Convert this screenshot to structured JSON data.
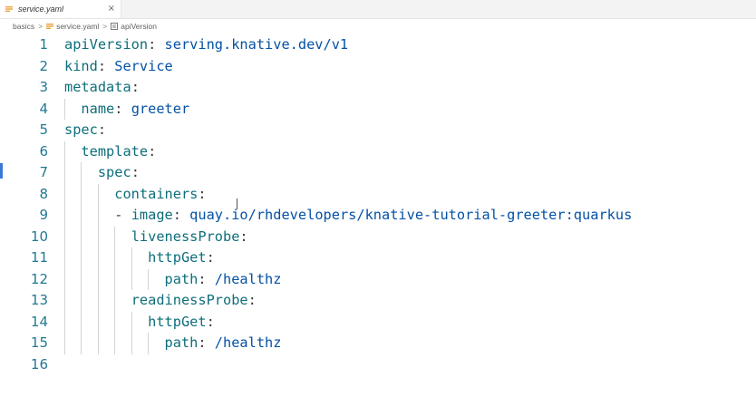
{
  "tab": {
    "label": "service.yaml",
    "close_glyph": "×",
    "icon": "yaml-file-icon"
  },
  "breadcrumb": {
    "items": [
      "basics",
      "service.yaml",
      "apiVersion"
    ],
    "separator": ">"
  },
  "editor": {
    "lines": [
      {
        "n": "1",
        "key": "apiVersion",
        "sep": ": ",
        "value": "serving.knative.dev/v1"
      },
      {
        "n": "2",
        "key": "kind",
        "sep": ": ",
        "value": "Service"
      },
      {
        "n": "3",
        "key": "metadata",
        "sep": ":",
        "value": ""
      },
      {
        "n": "4",
        "key": "name",
        "sep": ": ",
        "value": "greeter"
      },
      {
        "n": "5",
        "key": "spec",
        "sep": ":",
        "value": ""
      },
      {
        "n": "6",
        "key": "template",
        "sep": ":",
        "value": ""
      },
      {
        "n": "7",
        "key": "spec",
        "sep": ":",
        "value": ""
      },
      {
        "n": "8",
        "key": "containers",
        "sep": ":",
        "value": ""
      },
      {
        "n": "9",
        "dash": "- ",
        "key": "image",
        "sep": ": ",
        "value": "quay.io/rhdevelopers/knative-tutorial-greeter:quarkus"
      },
      {
        "n": "10",
        "key": "livenessProbe",
        "sep": ":",
        "value": ""
      },
      {
        "n": "11",
        "key": "httpGet",
        "sep": ":",
        "value": ""
      },
      {
        "n": "12",
        "key": "path",
        "sep": ": ",
        "value": "/healthz"
      },
      {
        "n": "13",
        "key": "readinessProbe",
        "sep": ":",
        "value": ""
      },
      {
        "n": "14",
        "key": "httpGet",
        "sep": ":",
        "value": ""
      },
      {
        "n": "15",
        "key": "path",
        "sep": ": ",
        "value": "/healthz"
      },
      {
        "n": "16",
        "key": "",
        "sep": "",
        "value": ""
      }
    ]
  },
  "colors": {
    "key": "#800000",
    "value": "#0451a5",
    "line_number": "#237893",
    "modified_gutter": "#3a79d6"
  }
}
